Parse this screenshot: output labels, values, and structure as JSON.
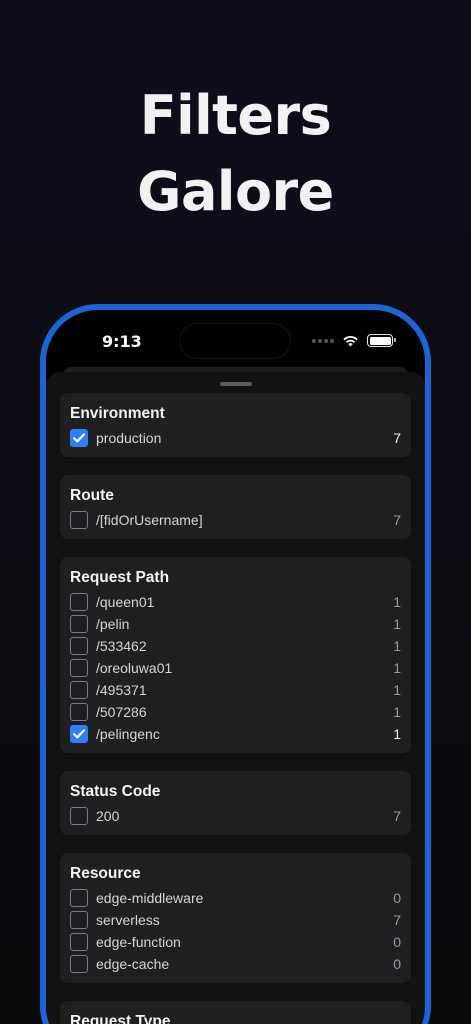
{
  "headline": {
    "line1": "Filters",
    "line2": "Galore"
  },
  "status_bar": {
    "time": "9:13"
  },
  "sections": [
    {
      "title": "Environment",
      "items": [
        {
          "label": "production",
          "count": "7",
          "checked": true
        }
      ]
    },
    {
      "title": "Route",
      "items": [
        {
          "label": "/[fidOrUsername]",
          "count": "7",
          "checked": false
        }
      ]
    },
    {
      "title": "Request Path",
      "items": [
        {
          "label": "/queen01",
          "count": "1",
          "checked": false
        },
        {
          "label": "/pelin",
          "count": "1",
          "checked": false
        },
        {
          "label": "/533462",
          "count": "1",
          "checked": false
        },
        {
          "label": "/oreoluwa01",
          "count": "1",
          "checked": false
        },
        {
          "label": "/495371",
          "count": "1",
          "checked": false
        },
        {
          "label": "/507286",
          "count": "1",
          "checked": false
        },
        {
          "label": "/pelingenc",
          "count": "1",
          "checked": true
        }
      ]
    },
    {
      "title": "Status Code",
      "items": [
        {
          "label": "200",
          "count": "7",
          "checked": false
        }
      ]
    },
    {
      "title": "Resource",
      "items": [
        {
          "label": "edge-middleware",
          "count": "0",
          "checked": false
        },
        {
          "label": "serverless",
          "count": "7",
          "checked": false
        },
        {
          "label": "edge-function",
          "count": "0",
          "checked": false
        },
        {
          "label": "edge-cache",
          "count": "0",
          "checked": false
        }
      ]
    },
    {
      "title": "Request Type",
      "items": []
    }
  ],
  "colors": {
    "accent": "#2d7ff9",
    "frame": "#1c63d6",
    "card": "#1f1f21"
  },
  "icons": {
    "checkbox_checked": "checkmark-icon",
    "wifi": "wifi-icon",
    "battery": "battery-icon",
    "signal": "cellular-signal-icon"
  }
}
